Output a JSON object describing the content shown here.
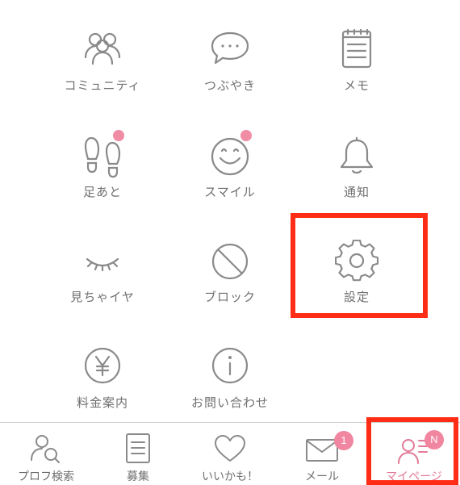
{
  "menu": {
    "items": [
      {
        "label": "コミュニティ",
        "icon": "community-icon"
      },
      {
        "label": "つぶやき",
        "icon": "speech-bubble-icon"
      },
      {
        "label": "メモ",
        "icon": "memo-icon"
      },
      {
        "label": "足あと",
        "icon": "footprints-icon"
      },
      {
        "label": "スマイル",
        "icon": "smile-icon"
      },
      {
        "label": "通知",
        "icon": "bell-icon"
      },
      {
        "label": "見ちゃイヤ",
        "icon": "closed-eye-icon"
      },
      {
        "label": "ブロック",
        "icon": "block-icon"
      },
      {
        "label": "設定",
        "icon": "gear-icon"
      },
      {
        "label": "料金案内",
        "icon": "yen-icon"
      },
      {
        "label": "お問い合わせ",
        "icon": "info-icon"
      }
    ]
  },
  "tabbar": {
    "tabs": [
      {
        "label": "プロフ検索",
        "icon": "profile-search-icon"
      },
      {
        "label": "募集",
        "icon": "list-icon"
      },
      {
        "label": "いいかも！",
        "icon": "heart-icon"
      },
      {
        "label": "メール",
        "icon": "mail-icon",
        "badge": "1"
      },
      {
        "label": "マイページ",
        "icon": "mypage-icon",
        "badge": "N",
        "active": true
      }
    ]
  },
  "colors": {
    "icon_gray": "#8a8a8a",
    "label_gray": "#6f6f6f",
    "accent_pink": "#f08ca4",
    "highlight_red": "#ff2d16"
  }
}
